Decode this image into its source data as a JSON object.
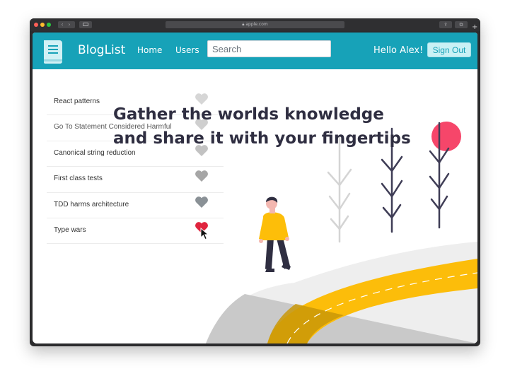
{
  "browser": {
    "address": "apple.com",
    "nav_glyphs": "‹ ›",
    "share_glyph": "⇪",
    "tabs_glyph": "⧉",
    "plus_glyph": "+"
  },
  "navbar": {
    "brand": "BlogList",
    "links": [
      "Home",
      "Users"
    ],
    "search_placeholder": "Search",
    "greeting": "Hello Alex!",
    "signout_label": "Sign Out",
    "color": "#17a2b8"
  },
  "blogs": [
    {
      "title": "React patterns",
      "liked": false,
      "heart_color": "#d6d6d6"
    },
    {
      "title": "Go To Statement Considered Harmful",
      "liked": false,
      "heart_color": "#cfcfcf"
    },
    {
      "title": "Canonical string reduction",
      "liked": false,
      "heart_color": "#c2c2c2"
    },
    {
      "title": "First class tests",
      "liked": false,
      "heart_color": "#a6a6a6"
    },
    {
      "title": "TDD harms architecture",
      "liked": false,
      "heart_color": "#8a9196"
    },
    {
      "title": "Type wars",
      "liked": true,
      "heart_color": "#e0243e"
    }
  ],
  "hero": {
    "line1": "Gather the worlds knowledge",
    "line2": "and share it with your fingertips"
  },
  "colors": {
    "accent": "#17a2b8",
    "road": "#fcbd0a",
    "sun": "#f6466a",
    "shirt": "#fdbe09"
  }
}
